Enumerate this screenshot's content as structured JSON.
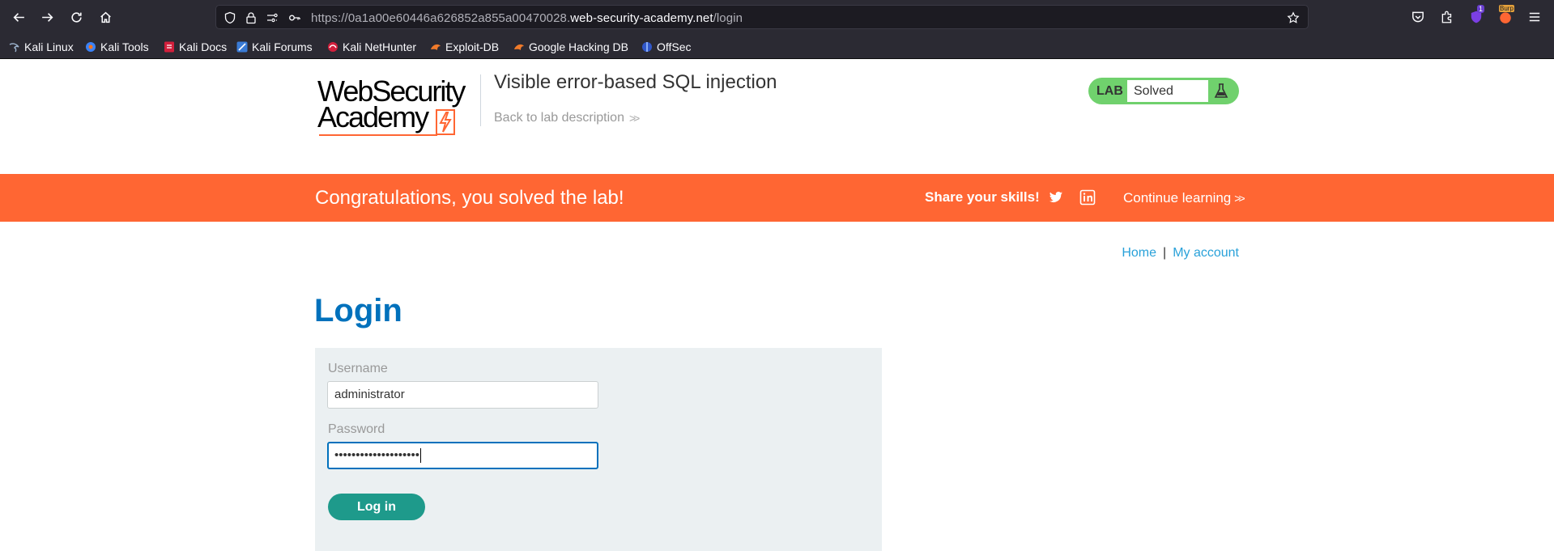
{
  "browser": {
    "url_prefix": "https://0a1a00e60446a626852a855a00470028.",
    "url_host": "web-security-academy.net",
    "url_path": "/login",
    "bookmarks": [
      {
        "label": "Kali Linux"
      },
      {
        "label": "Kali Tools"
      },
      {
        "label": "Kali Docs"
      },
      {
        "label": "Kali Forums"
      },
      {
        "label": "Kali NetHunter"
      },
      {
        "label": "Exploit-DB"
      },
      {
        "label": "Google Hacking DB"
      },
      {
        "label": "OffSec"
      }
    ],
    "extension_badge": "1",
    "burp_badge": "Burp"
  },
  "header": {
    "logo_line1": "WebSecurity",
    "logo_line2": "Academy",
    "lab_title": "Visible error-based SQL injection",
    "back_link": "Back to lab description",
    "lab_label": "LAB",
    "lab_status": "Solved",
    "status_color": "#70d16d"
  },
  "banner": {
    "message": "Congratulations, you solved the lab!",
    "share": "Share your skills!",
    "continue": "Continue learning",
    "color": "#ff6633"
  },
  "nav": {
    "home": "Home",
    "separator": "|",
    "account": "My account"
  },
  "login": {
    "heading": "Login",
    "username_label": "Username",
    "username_value": "administrator",
    "password_label": "Password",
    "password_value": "••••••••••••••••••••",
    "submit": "Log in"
  }
}
